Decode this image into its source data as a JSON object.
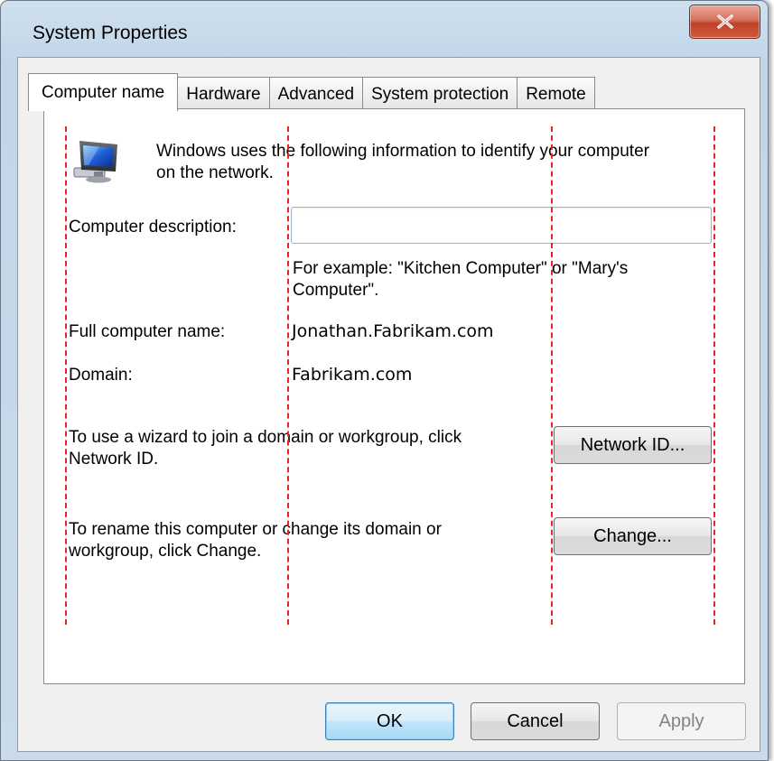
{
  "window": {
    "title": "System Properties",
    "close_glyph": "X",
    "close_icon": "close-icon"
  },
  "tabs": [
    {
      "label": "Computer name",
      "active": true
    },
    {
      "label": "Hardware",
      "active": false
    },
    {
      "label": "Advanced",
      "active": false
    },
    {
      "label": "System protection",
      "active": false
    },
    {
      "label": "Remote",
      "active": false
    }
  ],
  "computer_name_tab": {
    "icon": "computer-network-icon",
    "intro_lines": [
      "Windows uses the following information to identify your computer",
      "on the network."
    ],
    "description": {
      "label": "Computer description:",
      "value": "",
      "placeholder": "",
      "example_lines": [
        "For example: \"Kitchen Computer\" or \"Mary's",
        "Computer\"."
      ]
    },
    "full_name": {
      "label": "Full computer name:",
      "value": "Jonathan.Fabrikam.com"
    },
    "domain": {
      "label": "Domain:",
      "value": "Fabrikam.com"
    },
    "network_id": {
      "text_lines": [
        "To use a wizard to join a domain or workgroup, click",
        "Network ID."
      ],
      "button": "Network ID..."
    },
    "change": {
      "text_lines": [
        "To rename this computer or change its domain or",
        "workgroup, click Change."
      ],
      "button": "Change..."
    }
  },
  "footer": {
    "ok": "OK",
    "cancel": "Cancel",
    "apply": "Apply"
  },
  "colors": {
    "guide_lines": "#ee2222",
    "default_button": "#3c7fb1",
    "close_button": "#c0412a"
  }
}
